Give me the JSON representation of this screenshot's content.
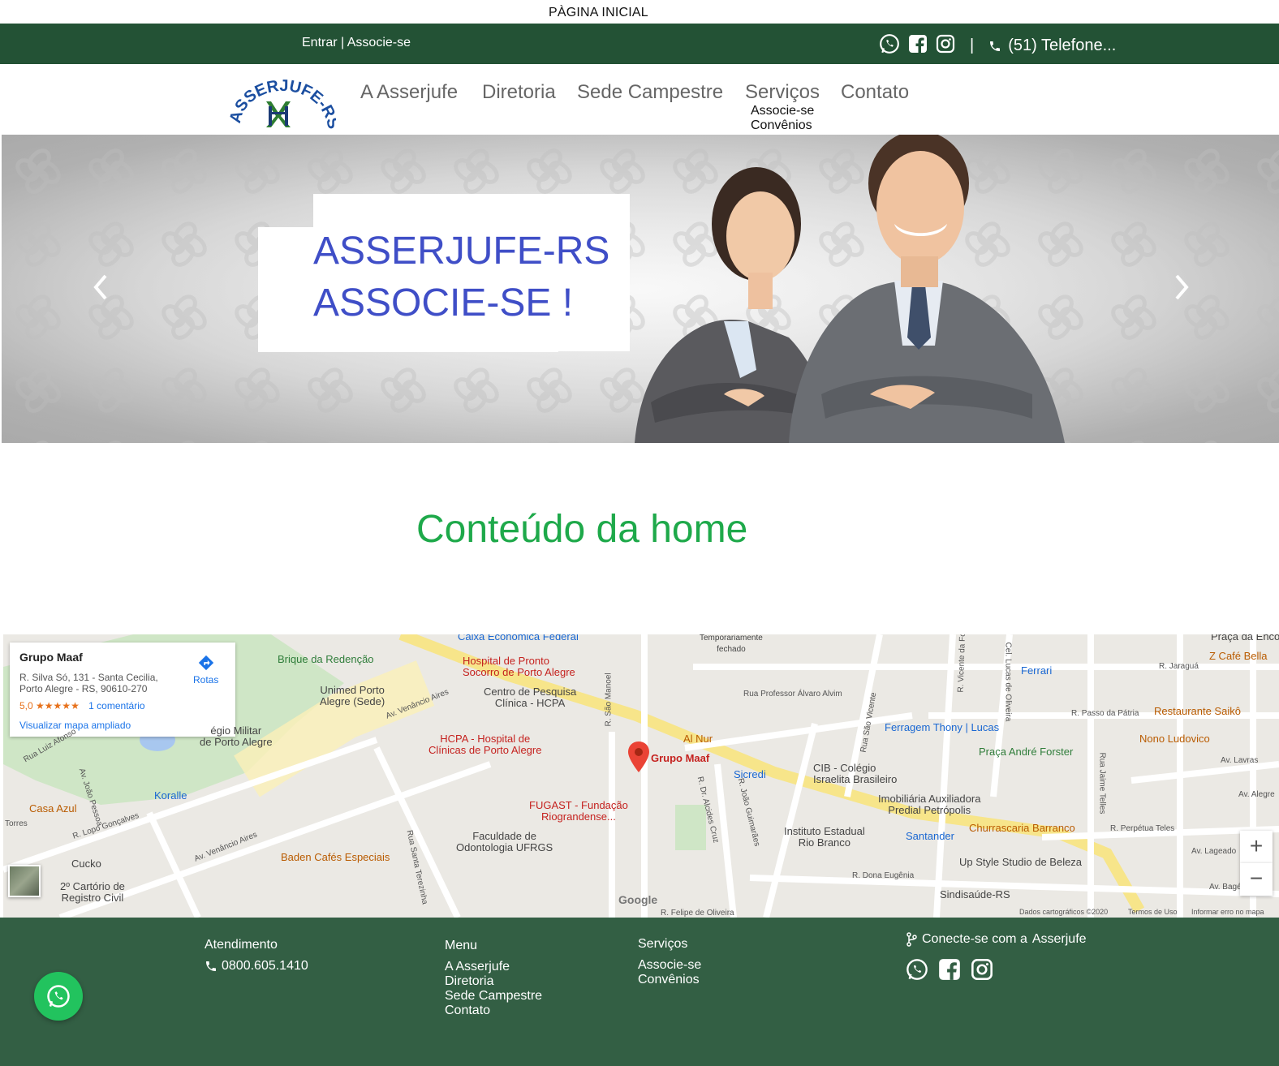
{
  "page_title": "PÀGINA INICIAL",
  "topbar": {
    "login_label": "Entrar",
    "separator": "|",
    "register_label": "Associe-se",
    "phone_label": "(51) Telefone..."
  },
  "nav": {
    "logo_text": "ASSERJUFE-RS",
    "items": [
      "A Asserjufe",
      "Diretoria",
      "Sede Campestre",
      "Serviços",
      "Contato"
    ],
    "submenu": [
      "Associe-se",
      "Convênios"
    ]
  },
  "hero": {
    "line1": "ASSERJUFE-RS",
    "line2": "ASSOCIE-SE !"
  },
  "content": {
    "heading": "Conteúdo da home"
  },
  "map": {
    "place_name": "Grupo Maaf",
    "address": "R. Silva Só, 131 - Santa Cecilia, Porto Alegre - RS, 90610-270",
    "rating": "5,0",
    "stars": "★★★★★",
    "comments": "1 comentário",
    "directions_label": "Rotas",
    "enlarge_link": "Visualizar mapa ampliado",
    "labels": {
      "caixa": "Caixa Econômica Federal",
      "temp_closed": "Temporariamente\nfechado",
      "praca_encol": "Praça da Enco",
      "brique": "Brique da Redenção",
      "hpsp": "Hospital de Pronto\nSocorro de Porto Alegre",
      "ferrari": "Ferrari",
      "zcafe": "Z Café Bella",
      "unimed": "Unimed Porto\nAlegre (Sede)",
      "hcpa_centro": "Centro de Pesquisa\nClínica - HCPA",
      "restaurante_saiko": "Restaurante Saikô",
      "colegio_militar": "égio Militar\nde Porto Alegre",
      "alnur": "Al Nur",
      "ferragem": "Ferragem Thony | Lucas",
      "nono": "Nono Ludovico",
      "hcpa": "HCPA - Hospital de\nClínicas de Porto Alegre",
      "grupo_maaf": "Grupo Maaf",
      "praca_andre": "Praça André Forster",
      "cib": "CIB - Colégio\nIsraelita Brasileiro",
      "sicredi": "Sicredi",
      "koralle": "Koralle",
      "casa_azul": "Casa Azul",
      "fugast": "FUGAST - Fundação\nRiograndense...",
      "imobiliaria": "Imobiliária Auxiliadora\nPredial Petrópolis",
      "instituto": "Instituto Estadual\nRio Branco",
      "santander": "Santander",
      "churrascaria": "Churrascaria Barranco",
      "faculdade": "Faculdade de\nOdontologia UFRGS",
      "baden": "Baden Cafés Especiais",
      "cucko": "Cucko",
      "cartorio": "2º Cartório de\nRegistro Civil",
      "upstyle": "Up Style Studio de Beleza",
      "sindisaude": "Sindisaúde-RS"
    },
    "streets": {
      "s1": "Rua Professor Álvaro Alvim",
      "s2": "R. Passo da Pátria",
      "s3": "R. Jaraguá",
      "s4": "Av. Lavras",
      "s5": "Av. Alegre",
      "s6": "R. Perpétua Teles",
      "s7": "Av. Lageado",
      "s8": "Av. Bagé",
      "s9": "R. Dona Eugênia",
      "s10": "Av. João Pessoa",
      "s11": "Rua Santa Terezinha",
      "s12": "Av. Venâncio Aires",
      "s13": "R. Lopo Gonçalves",
      "s14": "R. São Manoel",
      "s15": "R. Dr. Alcides Cruz",
      "s16": "R. João Guimarães",
      "s17": "Rua São Vicente",
      "s18": "Rua Jaime Telles",
      "s19": "Cel. Lucas de Oliveira",
      "s20": "R. Vicente da Fontoura",
      "s21": "R. Felipe de Oliveira",
      "s22": "Av. Venâncio Aires",
      "s23": "Rua Luiz Afonso",
      "s24": "Torres"
    },
    "google_label": "Google",
    "data_credit": "Dados cartográficos ©2020",
    "terms": "Termos de Uso",
    "report": "Informar erro no mapa"
  },
  "footer": {
    "atendimento_head": "Atendimento",
    "phone": "0800.605.1410",
    "menu_head": "Menu",
    "menu_items": [
      "A Asserjufe",
      "Diretoria",
      "Sede Campestre",
      "Contato"
    ],
    "servicos_head": "Serviços",
    "servicos_items": [
      "Associe-se",
      "Convênios"
    ],
    "connect_label": "Conecte-se com a",
    "connect_brand": "Asserjufe"
  },
  "colors": {
    "topbar": "#235235",
    "footer": "#335f44",
    "hero_text": "#3f4ec7",
    "content_heading": "#1ea94a",
    "whatsapp": "#22c35e"
  },
  "icons": [
    "whatsapp-icon",
    "facebook-icon",
    "instagram-icon",
    "phone-icon",
    "chevron-left-icon",
    "chevron-right-icon",
    "map-pin-icon",
    "directions-icon",
    "zoom-in-icon",
    "zoom-out-icon",
    "share-icon"
  ]
}
